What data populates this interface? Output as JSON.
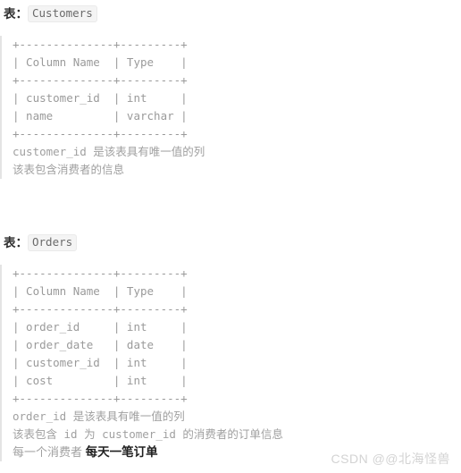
{
  "page": {
    "background": "#ffffff",
    "text_color_mono": "#9a9a9a",
    "heading_color": "#2f2f2f",
    "badge_bg": "#f4f4f4",
    "quote_border": "#e4e4e4",
    "watermark_color": "#d3d3d3"
  },
  "sections": [
    {
      "heading_label": "表",
      "heading_colon": "：",
      "heading_code": "Customers",
      "ascii_table": "+--------------+---------+\n| Column Name  | Type    |\n+--------------+---------+\n| customer_id  | int     |\n| name         | varchar |\n+--------------+---------+",
      "table_rows": [
        {
          "column_name": "customer_id",
          "type": "int"
        },
        {
          "column_name": "name",
          "type": "varchar"
        }
      ],
      "table_headers": [
        "Column Name",
        "Type"
      ],
      "descriptions": [
        "customer_id 是该表具有唯一值的列",
        "该表包含消费者的信息"
      ]
    },
    {
      "heading_label": "表",
      "heading_colon": "：",
      "heading_code": "Orders",
      "ascii_table": "+--------------+---------+\n| Column Name  | Type    |\n+--------------+---------+\n| order_id     | int     |\n| order_date   | date    |\n| customer_id  | int     |\n| cost         | int     |\n+--------------+---------+",
      "table_rows": [
        {
          "column_name": "order_id",
          "type": "int"
        },
        {
          "column_name": "order_date",
          "type": "date"
        },
        {
          "column_name": "customer_id",
          "type": "int"
        },
        {
          "column_name": "cost",
          "type": "int"
        }
      ],
      "table_headers": [
        "Column Name",
        "Type"
      ],
      "descriptions": [
        "order_id 是该表具有唯一值的列",
        "该表包含 id 为 customer_id 的消费者的订单信息"
      ],
      "final_note_normal": "每一个消费者 ",
      "final_note_bold": "每天一笔订单"
    }
  ],
  "watermark": "CSDN @@北海怪兽"
}
